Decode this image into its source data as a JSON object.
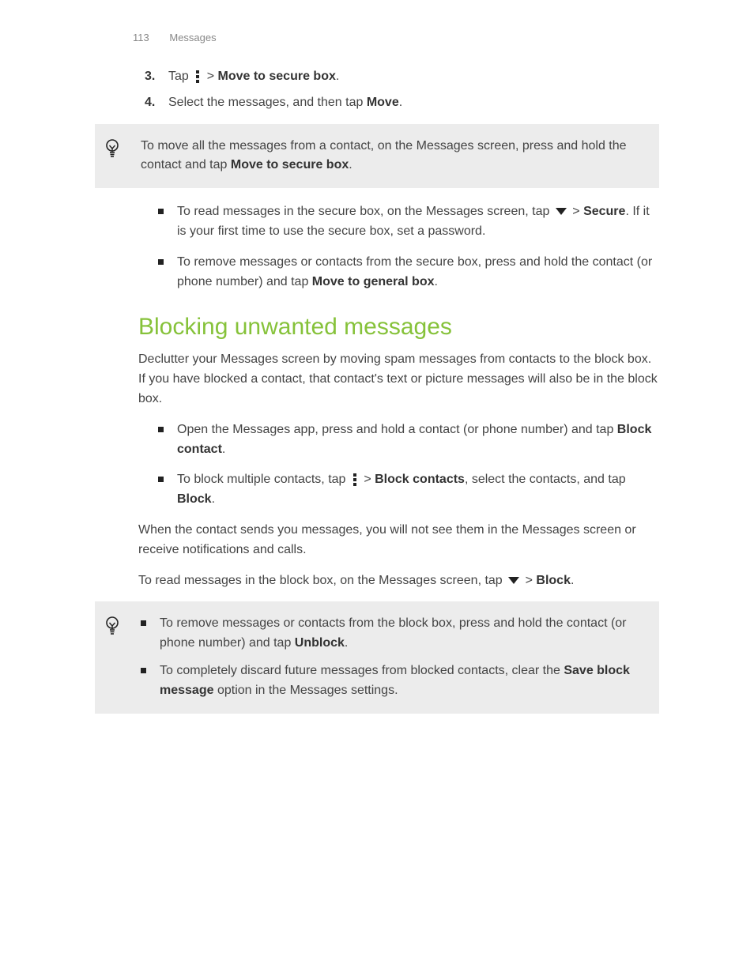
{
  "header": {
    "page_number": "113",
    "section": "Messages"
  },
  "steps": {
    "s3": {
      "num": "3.",
      "pre": "Tap ",
      "post": " > ",
      "bold": "Move to secure box",
      "end": "."
    },
    "s4": {
      "num": "4.",
      "text_a": "Select the messages, and then tap ",
      "bold": "Move",
      "text_b": "."
    }
  },
  "tip1": {
    "text_a": "To move all the messages from a contact, on the Messages screen, press and hold the contact and tap ",
    "bold": "Move to secure box",
    "text_b": "."
  },
  "bullets1": {
    "b1": {
      "a": "To read messages in the secure box, on the Messages screen, tap ",
      "b": " > ",
      "bold": "Secure",
      "c": ". If it is your first time to use the secure box, set a password."
    },
    "b2": {
      "a": "To remove messages or contacts from the secure box, press and hold the contact (or phone number) and tap ",
      "bold": "Move to general box",
      "b": "."
    }
  },
  "heading": "Blocking unwanted messages",
  "intro": "Declutter your Messages screen by moving spam messages from contacts to the block box. If you have blocked a contact, that contact's text or picture messages will also be in the block box.",
  "bullets2": {
    "b1": {
      "a": "Open the Messages app, press and hold a contact (or phone number) and tap ",
      "bold": "Block contact",
      "b": "."
    },
    "b2": {
      "a": "To block multiple contacts, tap ",
      "b": " > ",
      "bold1": "Block contacts",
      "c": ", select the contacts, and tap ",
      "bold2": "Block",
      "d": "."
    }
  },
  "para1": "When the contact sends you messages, you will not see them in the Messages screen or receive notifications and calls.",
  "para2": {
    "a": "To read messages in the block box, on the Messages screen, tap ",
    "b": " > ",
    "bold": "Block",
    "c": "."
  },
  "tip2": {
    "b1": {
      "a": "To remove messages or contacts from the block box, press and hold the contact (or phone number) and tap ",
      "bold": "Unblock",
      "b": "."
    },
    "b2": {
      "a": "To completely discard future messages from blocked contacts, clear the ",
      "bold": "Save block message",
      "b": " option in the Messages settings."
    }
  }
}
